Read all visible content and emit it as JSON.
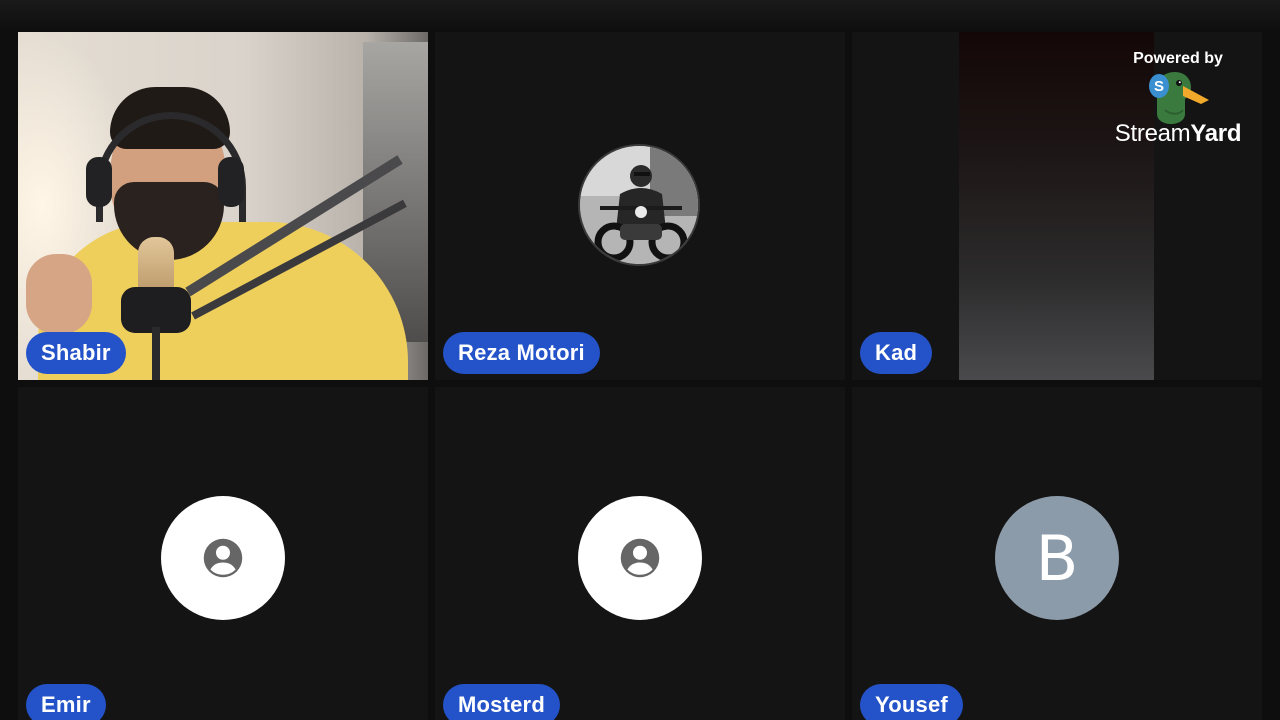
{
  "branding": {
    "powered_by": "Powered by",
    "name_regular": "Stream",
    "name_bold": "Yard",
    "logo_icon": "streamyard-duck-logo",
    "colors": {
      "duck_blue": "#3a8fd0",
      "beak": "#f0a92a",
      "duck_green": "#3a7a3e"
    }
  },
  "participants": [
    {
      "name": "Shabir",
      "type": "video"
    },
    {
      "name": "Reza Motori",
      "type": "photo-avatar",
      "icon": "motorcycle-photo"
    },
    {
      "name": "Kad",
      "type": "video"
    },
    {
      "name": "Emir",
      "type": "placeholder",
      "icon": "user-icon"
    },
    {
      "name": "Mosterd",
      "type": "placeholder",
      "icon": "user-icon"
    },
    {
      "name": "Yousef",
      "type": "letter-avatar",
      "initial": "B"
    }
  ],
  "colors": {
    "name_tag": "#2453c9",
    "tile_bg": "#141415",
    "letter_avatar": "#8c9ba9"
  }
}
